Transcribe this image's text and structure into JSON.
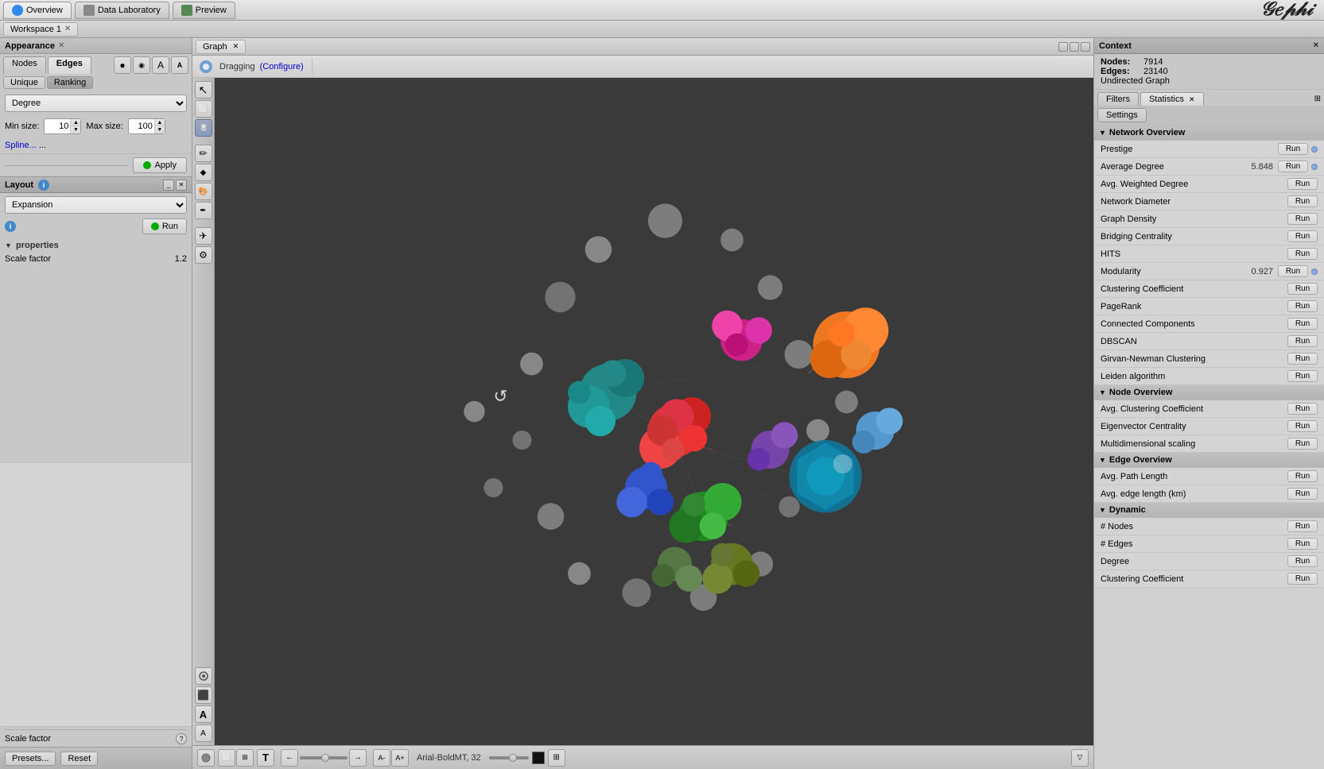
{
  "topbar": {
    "tabs": [
      {
        "id": "overview",
        "label": "Overview",
        "active": true
      },
      {
        "id": "data-laboratory",
        "label": "Data Laboratory",
        "active": false
      },
      {
        "id": "preview",
        "label": "Preview",
        "active": false
      }
    ]
  },
  "workspace": {
    "tab_label": "Workspace 1"
  },
  "appearance": {
    "title": "Appearance",
    "ne_tabs": [
      "Nodes",
      "Edges"
    ],
    "active_ne_tab": "Edges",
    "ur_tabs": [
      "Unique",
      "Ranking"
    ],
    "active_ur_tab": "Ranking",
    "dropdown_value": "Degree",
    "min_size_label": "Min size:",
    "min_size_value": "10",
    "max_size_label": "Max size:",
    "max_size_value": "100",
    "spline_label": "Spline...",
    "apply_label": "Apply"
  },
  "layout": {
    "title": "Layout",
    "dropdown_value": "Expansion",
    "run_label": "Run",
    "properties_title": "properties",
    "scale_factor_label": "Scale factor",
    "scale_factor_value": "1.2",
    "bottom_presets": "Presets...",
    "bottom_reset": "Reset",
    "scale_factor_help": "Scale factor"
  },
  "graph": {
    "tab_label": "Graph",
    "dragging_label": "Dragging",
    "configure_label": "(Configure)"
  },
  "context": {
    "title": "Context",
    "nodes_label": "Nodes:",
    "nodes_value": "7914",
    "edges_label": "Edges:",
    "edges_value": "23140",
    "graph_type": "Undirected Graph",
    "tabs": [
      "Filters",
      "Statistics"
    ],
    "active_tab": "Statistics",
    "settings_btn": "Settings",
    "sections": {
      "network_overview": {
        "title": "Network Overview",
        "items": [
          {
            "name": "Prestige",
            "value": "",
            "has_dot": true
          },
          {
            "name": "Average Degree",
            "value": "5.848",
            "has_dot": true
          },
          {
            "name": "Avg. Weighted Degree",
            "value": "",
            "has_dot": false
          },
          {
            "name": "Network Diameter",
            "value": "",
            "has_dot": false
          },
          {
            "name": "Graph Density",
            "value": "",
            "has_dot": false
          },
          {
            "name": "Bridging Centrality",
            "value": "",
            "has_dot": false
          },
          {
            "name": "HITS",
            "value": "",
            "has_dot": false
          },
          {
            "name": "Modularity",
            "value": "0.927",
            "has_dot": true
          },
          {
            "name": "Clustering Coefficient",
            "value": "",
            "has_dot": false
          },
          {
            "name": "PageRank",
            "value": "",
            "has_dot": false
          },
          {
            "name": "Connected Components",
            "value": "",
            "has_dot": false
          },
          {
            "name": "DBSCAN",
            "value": "",
            "has_dot": false
          },
          {
            "name": "Girvan-Newman Clustering",
            "value": "",
            "has_dot": false
          },
          {
            "name": "Leiden algorithm",
            "value": "",
            "has_dot": false
          }
        ]
      },
      "node_overview": {
        "title": "Node Overview",
        "items": [
          {
            "name": "Avg. Clustering Coefficient",
            "value": "",
            "has_dot": false
          },
          {
            "name": "Eigenvector Centrality",
            "value": "",
            "has_dot": false
          },
          {
            "name": "Multidimensional scaling",
            "value": "",
            "has_dot": false
          }
        ]
      },
      "edge_overview": {
        "title": "Edge Overview",
        "items": [
          {
            "name": "Avg. Path Length",
            "value": "",
            "has_dot": false
          },
          {
            "name": "Avg. edge length (km)",
            "value": "",
            "has_dot": false
          }
        ]
      },
      "dynamic": {
        "title": "Dynamic",
        "items": [
          {
            "name": "# Nodes",
            "value": "",
            "has_dot": false
          },
          {
            "name": "# Edges",
            "value": "",
            "has_dot": false
          },
          {
            "name": "Degree",
            "value": "",
            "has_dot": false
          },
          {
            "name": "Clustering Coefficient",
            "value": "",
            "has_dot": false
          }
        ]
      }
    }
  },
  "bottom_toolbar": {
    "font_label": "Arial-BoldMT, 32"
  },
  "icons": {
    "close": "✕",
    "triangle_right": "▶",
    "triangle_down": "▼",
    "arrow_up": "▲",
    "arrow_down": "▼",
    "circle": "●",
    "cursor": "↖",
    "rect_select": "⬜",
    "move": "✋",
    "zoom": "🔍",
    "text": "T",
    "pencil": "✏",
    "node_icon": "⬡",
    "settings": "⚙",
    "path": "⌒"
  }
}
